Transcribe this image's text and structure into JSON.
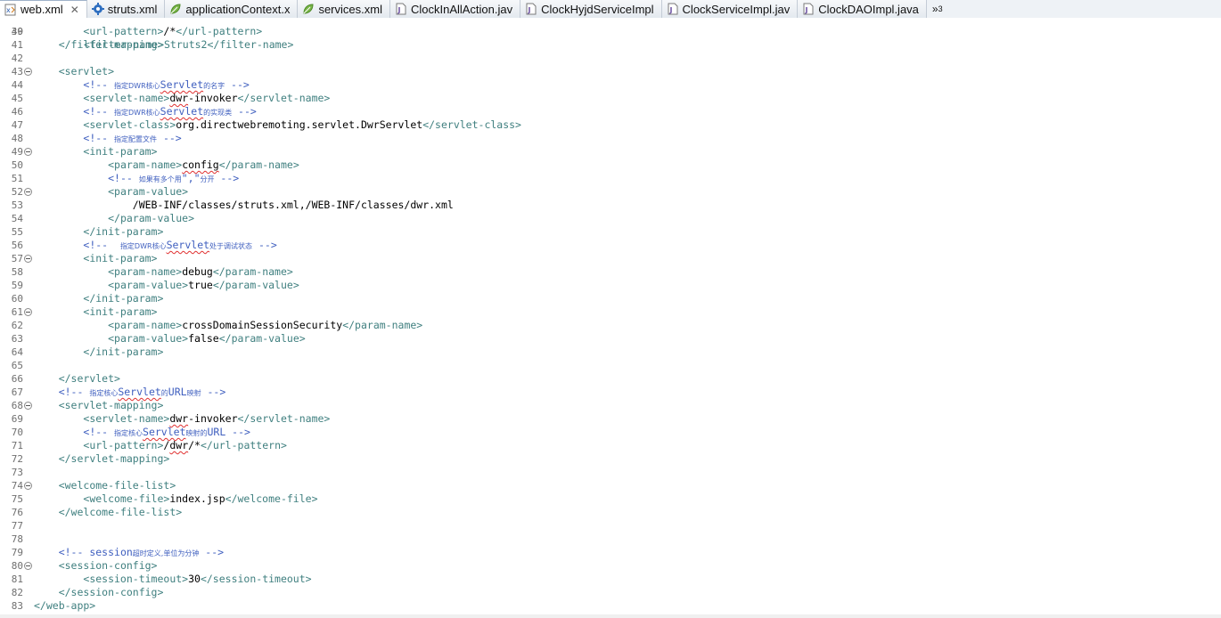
{
  "tabs": [
    {
      "label": "web.xml",
      "icon": "xml-file-icon",
      "active": true,
      "closable": true
    },
    {
      "label": "struts.xml",
      "icon": "gear-icon",
      "active": false
    },
    {
      "label": "applicationContext.x",
      "icon": "spring-leaf-icon",
      "active": false
    },
    {
      "label": "services.xml",
      "icon": "spring-leaf-icon",
      "active": false
    },
    {
      "label": "ClockInAllAction.jav",
      "icon": "java-file-icon",
      "active": false
    },
    {
      "label": "ClockHyjdServiceImpl",
      "icon": "java-file-icon",
      "active": false
    },
    {
      "label": "ClockServiceImpl.jav",
      "icon": "java-file-icon",
      "active": false
    },
    {
      "label": "ClockDAOImpl.java",
      "icon": "java-file-icon",
      "active": false
    }
  ],
  "overflow": {
    "symbol": "»",
    "count": "3"
  },
  "partial_top_line": {
    "number": "39",
    "text": "<filter-name>Struts2</filter-name>"
  },
  "lines": [
    {
      "n": "40",
      "fold": false,
      "segs": [
        [
          "t",
          "        "
        ],
        [
          "g",
          "<url-pattern>"
        ],
        [
          "x",
          "/*"
        ],
        [
          "g",
          "</url-pattern>"
        ]
      ]
    },
    {
      "n": "41",
      "fold": false,
      "segs": [
        [
          "t",
          "    "
        ],
        [
          "g",
          "</filter-mapping>"
        ]
      ]
    },
    {
      "n": "42",
      "fold": false,
      "segs": []
    },
    {
      "n": "43",
      "fold": true,
      "segs": [
        [
          "t",
          "    "
        ],
        [
          "g",
          "<servlet>"
        ]
      ]
    },
    {
      "n": "44",
      "fold": false,
      "segs": [
        [
          "t",
          "        "
        ],
        [
          "c",
          "<!-- "
        ],
        [
          "k",
          "指定DWR核心"
        ],
        [
          "cs",
          "Servlet"
        ],
        [
          "k",
          "的名字"
        ],
        [
          "c",
          " -->"
        ]
      ]
    },
    {
      "n": "45",
      "fold": false,
      "segs": [
        [
          "t",
          "        "
        ],
        [
          "g",
          "<servlet-name>"
        ],
        [
          "xs",
          "dwr"
        ],
        [
          "x",
          "-invoker"
        ],
        [
          "g",
          "</servlet-name>"
        ]
      ]
    },
    {
      "n": "46",
      "fold": false,
      "segs": [
        [
          "t",
          "        "
        ],
        [
          "c",
          "<!-- "
        ],
        [
          "k",
          "指定DWR核心"
        ],
        [
          "cs",
          "Servlet"
        ],
        [
          "k",
          "的实现类"
        ],
        [
          "c",
          " -->"
        ]
      ]
    },
    {
      "n": "47",
      "fold": false,
      "segs": [
        [
          "t",
          "        "
        ],
        [
          "g",
          "<servlet-class>"
        ],
        [
          "x",
          "org.directwebremoting.servlet.DwrServlet"
        ],
        [
          "g",
          "</servlet-class>"
        ]
      ]
    },
    {
      "n": "48",
      "fold": false,
      "segs": [
        [
          "t",
          "        "
        ],
        [
          "c",
          "<!-- "
        ],
        [
          "k",
          "指定配置文件"
        ],
        [
          "c",
          " -->"
        ]
      ]
    },
    {
      "n": "49",
      "fold": true,
      "segs": [
        [
          "t",
          "        "
        ],
        [
          "g",
          "<init-param>"
        ]
      ]
    },
    {
      "n": "50",
      "fold": false,
      "segs": [
        [
          "t",
          "            "
        ],
        [
          "g",
          "<param-name>"
        ],
        [
          "xs",
          "config"
        ],
        [
          "g",
          "</param-name>"
        ]
      ]
    },
    {
      "n": "51",
      "fold": false,
      "segs": [
        [
          "t",
          "            "
        ],
        [
          "c",
          "<!-- "
        ],
        [
          "k",
          "如果有多个用"
        ],
        [
          "c",
          "\",\""
        ],
        [
          "k",
          "分开"
        ],
        [
          "c",
          " -->"
        ]
      ]
    },
    {
      "n": "52",
      "fold": true,
      "segs": [
        [
          "t",
          "            "
        ],
        [
          "g",
          "<param-value>"
        ]
      ]
    },
    {
      "n": "53",
      "fold": false,
      "segs": [
        [
          "t",
          "                "
        ],
        [
          "x",
          "/WEB-INF/classes/struts.xml,/WEB-INF/classes/dwr.xml"
        ]
      ]
    },
    {
      "n": "54",
      "fold": false,
      "segs": [
        [
          "t",
          "            "
        ],
        [
          "g",
          "</param-value>"
        ]
      ]
    },
    {
      "n": "55",
      "fold": false,
      "segs": [
        [
          "t",
          "        "
        ],
        [
          "g",
          "</init-param>"
        ]
      ]
    },
    {
      "n": "56",
      "fold": false,
      "segs": [
        [
          "t",
          "        "
        ],
        [
          "c",
          "<!--  "
        ],
        [
          "k",
          "指定DWR核心"
        ],
        [
          "cs",
          "Servlet"
        ],
        [
          "k",
          "处于调试状态"
        ],
        [
          "c",
          " -->"
        ]
      ]
    },
    {
      "n": "57",
      "fold": true,
      "segs": [
        [
          "t",
          "        "
        ],
        [
          "g",
          "<init-param>"
        ]
      ]
    },
    {
      "n": "58",
      "fold": false,
      "segs": [
        [
          "t",
          "            "
        ],
        [
          "g",
          "<param-name>"
        ],
        [
          "x",
          "debug"
        ],
        [
          "g",
          "</param-name>"
        ]
      ]
    },
    {
      "n": "59",
      "fold": false,
      "segs": [
        [
          "t",
          "            "
        ],
        [
          "g",
          "<param-value>"
        ],
        [
          "x",
          "true"
        ],
        [
          "g",
          "</param-value>"
        ]
      ]
    },
    {
      "n": "60",
      "fold": false,
      "segs": [
        [
          "t",
          "        "
        ],
        [
          "g",
          "</init-param>"
        ]
      ]
    },
    {
      "n": "61",
      "fold": true,
      "segs": [
        [
          "t",
          "        "
        ],
        [
          "g",
          "<init-param>"
        ]
      ]
    },
    {
      "n": "62",
      "fold": false,
      "segs": [
        [
          "t",
          "            "
        ],
        [
          "g",
          "<param-name>"
        ],
        [
          "x",
          "crossDomainSessionSecurity"
        ],
        [
          "g",
          "</param-name>"
        ]
      ]
    },
    {
      "n": "63",
      "fold": false,
      "segs": [
        [
          "t",
          "            "
        ],
        [
          "g",
          "<param-value>"
        ],
        [
          "x",
          "false"
        ],
        [
          "g",
          "</param-value>"
        ]
      ]
    },
    {
      "n": "64",
      "fold": false,
      "segs": [
        [
          "t",
          "        "
        ],
        [
          "g",
          "</init-param>"
        ]
      ]
    },
    {
      "n": "65",
      "fold": false,
      "segs": []
    },
    {
      "n": "66",
      "fold": false,
      "segs": [
        [
          "t",
          "    "
        ],
        [
          "g",
          "</servlet>"
        ]
      ]
    },
    {
      "n": "67",
      "fold": false,
      "segs": [
        [
          "t",
          "    "
        ],
        [
          "c",
          "<!-- "
        ],
        [
          "k",
          "指定核心"
        ],
        [
          "cs",
          "Servlet"
        ],
        [
          "k",
          "的"
        ],
        [
          "c",
          "URL"
        ],
        [
          "k",
          "映射"
        ],
        [
          "c",
          " -->"
        ]
      ]
    },
    {
      "n": "68",
      "fold": true,
      "segs": [
        [
          "t",
          "    "
        ],
        [
          "g",
          "<servlet-mapping>"
        ]
      ]
    },
    {
      "n": "69",
      "fold": false,
      "segs": [
        [
          "t",
          "        "
        ],
        [
          "g",
          "<servlet-name>"
        ],
        [
          "xs",
          "dwr"
        ],
        [
          "x",
          "-invoker"
        ],
        [
          "g",
          "</servlet-name>"
        ]
      ]
    },
    {
      "n": "70",
      "fold": false,
      "segs": [
        [
          "t",
          "        "
        ],
        [
          "c",
          "<!-- "
        ],
        [
          "k",
          "指定核心"
        ],
        [
          "cs",
          "Servlet"
        ],
        [
          "k",
          "映射的"
        ],
        [
          "c",
          "URL -->"
        ]
      ]
    },
    {
      "n": "71",
      "fold": false,
      "segs": [
        [
          "t",
          "        "
        ],
        [
          "g",
          "<url-pattern>"
        ],
        [
          "x",
          "/"
        ],
        [
          "xs",
          "dwr"
        ],
        [
          "x",
          "/*"
        ],
        [
          "g",
          "</url-pattern>"
        ]
      ]
    },
    {
      "n": "72",
      "fold": false,
      "segs": [
        [
          "t",
          "    "
        ],
        [
          "g",
          "</servlet-mapping>"
        ]
      ]
    },
    {
      "n": "73",
      "fold": false,
      "segs": []
    },
    {
      "n": "74",
      "fold": true,
      "segs": [
        [
          "t",
          "    "
        ],
        [
          "g",
          "<welcome-file-list>"
        ]
      ]
    },
    {
      "n": "75",
      "fold": false,
      "segs": [
        [
          "t",
          "        "
        ],
        [
          "g",
          "<welcome-file>"
        ],
        [
          "x",
          "index.jsp"
        ],
        [
          "g",
          "</welcome-file>"
        ]
      ]
    },
    {
      "n": "76",
      "fold": false,
      "segs": [
        [
          "t",
          "    "
        ],
        [
          "g",
          "</welcome-file-list>"
        ]
      ]
    },
    {
      "n": "77",
      "fold": false,
      "segs": []
    },
    {
      "n": "78",
      "fold": false,
      "segs": []
    },
    {
      "n": "79",
      "fold": false,
      "segs": [
        [
          "t",
          "    "
        ],
        [
          "c",
          "<!-- session"
        ],
        [
          "k",
          "超时定义,单位为分钟"
        ],
        [
          "c",
          " -->"
        ]
      ]
    },
    {
      "n": "80",
      "fold": true,
      "segs": [
        [
          "t",
          "    "
        ],
        [
          "g",
          "<session-config>"
        ]
      ]
    },
    {
      "n": "81",
      "fold": false,
      "segs": [
        [
          "t",
          "        "
        ],
        [
          "g",
          "<session-timeout>"
        ],
        [
          "x",
          "30"
        ],
        [
          "g",
          "</session-timeout>"
        ]
      ]
    },
    {
      "n": "82",
      "fold": false,
      "segs": [
        [
          "t",
          "    "
        ],
        [
          "g",
          "</session-config>"
        ]
      ]
    },
    {
      "n": "83",
      "fold": false,
      "segs": [
        [
          "g",
          "</web-app>"
        ]
      ]
    }
  ]
}
